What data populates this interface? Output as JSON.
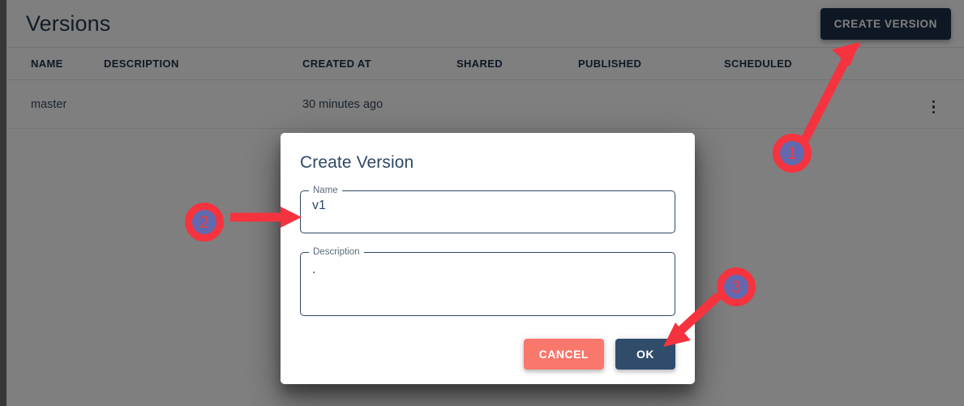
{
  "page": {
    "title": "Versions",
    "create_button_label": "CREATE VERSION"
  },
  "table": {
    "columns": [
      "NAME",
      "DESCRIPTION",
      "CREATED AT",
      "SHARED",
      "PUBLISHED",
      "SCHEDULED"
    ],
    "rows": [
      {
        "name": "master",
        "description": "",
        "created_at": "30 minutes ago",
        "shared": "",
        "published": "",
        "scheduled": "",
        "actions_icon": "kebab-menu-icon"
      }
    ]
  },
  "dialog": {
    "title": "Create Version",
    "name_field": {
      "label": "Name",
      "value": "v1",
      "placeholder": ""
    },
    "description_field": {
      "label": "Description",
      "value": ".",
      "placeholder": ""
    },
    "cancel_label": "CANCEL",
    "ok_label": "OK"
  },
  "annotations": {
    "badges": [
      {
        "id": "1",
        "label": "1"
      },
      {
        "id": "2",
        "label": "2"
      },
      {
        "id": "3",
        "label": "3"
      }
    ]
  },
  "colors": {
    "primary_dark": "#1d3048",
    "dialog_text": "#2d4866",
    "cancel": "#fa776b",
    "ok": "#2f4c6b",
    "annotation_red": "#f5333f",
    "badge_fill": "#6168ad"
  }
}
